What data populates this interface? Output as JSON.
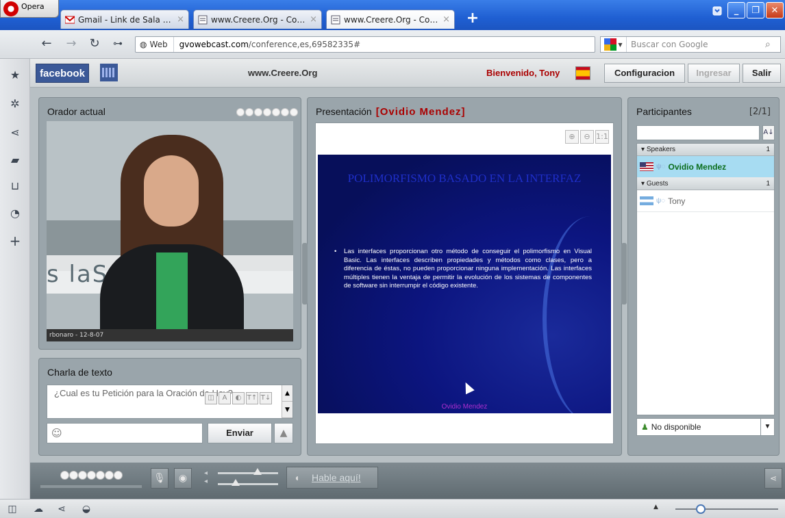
{
  "browser": {
    "menu_label": "Opera",
    "tabs": [
      {
        "title": "Gmail - Link de Sala para ...",
        "icon": "gmail-icon",
        "active": false
      },
      {
        "title": "www.Creere.Org - Conf...",
        "icon": "page-icon",
        "active": false
      },
      {
        "title": "www.Creere.Org - Conf...",
        "icon": "page-icon",
        "active": true
      }
    ],
    "address": {
      "site_label": "Web",
      "url_host": "gvowebcast.com",
      "url_path": "/conference,es,69582335#"
    },
    "search": {
      "placeholder": "Buscar con Google"
    }
  },
  "app": {
    "header": {
      "facebook_label": "facebook",
      "site_title": "www.Creere.Org",
      "welcome": "Bienvenido, Tony",
      "config_button": "Configuracion",
      "login_button": "Ingresar",
      "exit_button": "Salir"
    },
    "speaker": {
      "title": "Orador actual",
      "studio_text": "s   laS            xta|N",
      "ticker": "rbonaro - 12-8-07"
    },
    "chat": {
      "title": "Charla de texto",
      "input_value": "¿Cual es tu Petición para la Oración de Hoy?",
      "send_button": "Enviar"
    },
    "presentation": {
      "title": "Presentación",
      "presenter": "[Ovidio Mendez]",
      "zoom_reset": "1:1",
      "slide_title": "POLIMORFISMO BASADO EN LA INTERFAZ",
      "slide_bullet": "Las interfaces proporcionan otro método de conseguir el polimorfismo en Visual Basic. Las interfaces describen propiedades y métodos como clases, pero a diferencia de éstas, no pueden proporcionar ninguna implementación. Las interfaces múltiples tienen la ventaja de permitir la evolución de los sistemas de componentes de software sin interrumpir el código existente.",
      "slide_author": "Ovidio Mendez"
    },
    "participants": {
      "title": "Participantes",
      "count": "[2/1]",
      "groups": [
        {
          "label": "Speakers",
          "count": "1",
          "members": [
            {
              "name": "Ovidio Mendez",
              "flag": "us",
              "selected": true
            }
          ]
        },
        {
          "label": "Guests",
          "count": "1",
          "members": [
            {
              "name": "Tony",
              "flag": "ar",
              "selected": false
            }
          ]
        }
      ],
      "status_value": "No disponible"
    },
    "toolbar": {
      "talk_button": "Hable aquí!"
    }
  },
  "colors": {
    "accent_red": "#aa0000",
    "slide_bg": "#0c1580",
    "facebook_blue": "#3b5998",
    "selected_row": "#a7dcf2"
  }
}
